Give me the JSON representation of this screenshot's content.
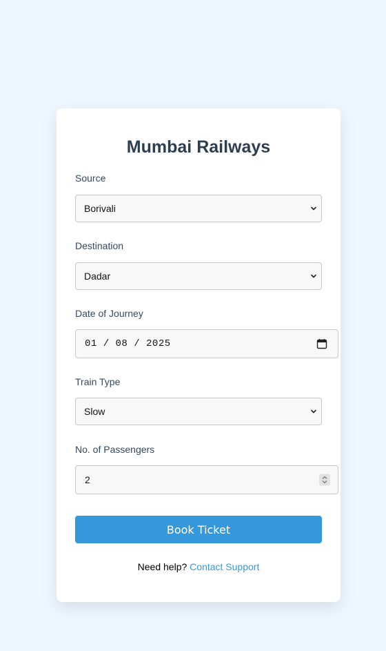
{
  "form": {
    "title": "Mumbai Railways",
    "source": {
      "label": "Source",
      "value": "Borivali"
    },
    "destination": {
      "label": "Destination",
      "value": "Dadar"
    },
    "date": {
      "label": "Date of Journey",
      "value": "01 / 08 / 2025"
    },
    "train_type": {
      "label": "Train Type",
      "value": "Slow"
    },
    "passengers": {
      "label": "No. of Passengers",
      "value": "2"
    },
    "submit_label": "Book Ticket",
    "help_text": "Need help?",
    "help_link": "Contact Support"
  },
  "colors": {
    "page_bg": "#eef6ff",
    "card_bg": "#ffffff",
    "accent": "#3498db",
    "title": "#2c3e50"
  }
}
